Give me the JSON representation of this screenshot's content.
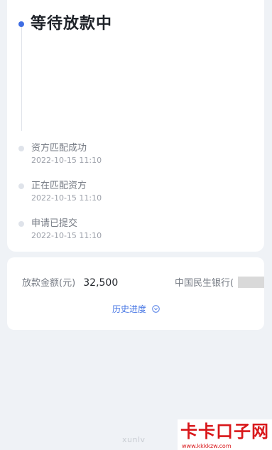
{
  "status": {
    "title": "等待放款中",
    "steps": [
      {
        "label": "资方匹配成功",
        "time": "2022-10-15 11:10"
      },
      {
        "label": "正在匹配资方",
        "time": "2022-10-15 11:10"
      },
      {
        "label": "申请已提交",
        "time": "2022-10-15 11:10"
      }
    ]
  },
  "loan": {
    "amount_label": "放款金额(元)",
    "amount_value": "32,500",
    "bank_name": "中国民生银行(",
    "history_label": "历史进度",
    "history_icon": "circle-chevron-down-icon"
  },
  "watermark": {
    "text": "xunlv",
    "logo": "卡卡口子网",
    "url": "www.kkkkzw.com"
  },
  "colors": {
    "accent": "#3f6de3",
    "link": "#4474e4",
    "background": "#eff2f6",
    "logo": "#d9171a"
  }
}
